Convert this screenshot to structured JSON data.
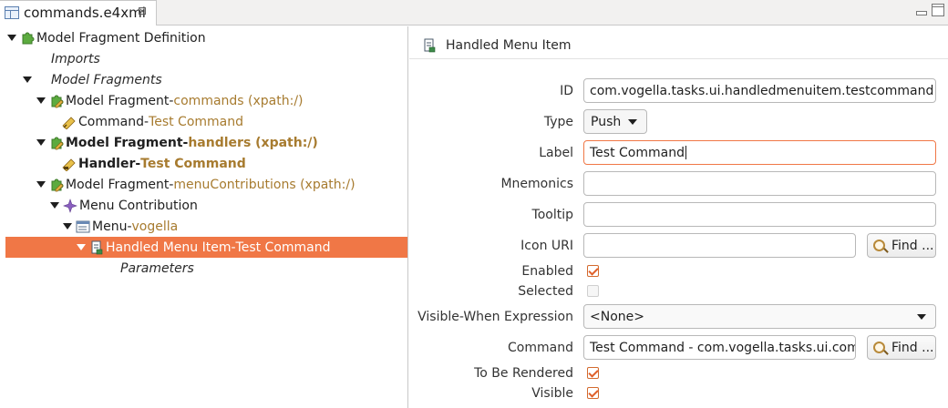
{
  "editor_tab": {
    "title": "commands.e4xmi",
    "close_glyph": "⊠"
  },
  "tree": {
    "rows": [
      {
        "main": "Model Fragment Definition",
        "dash": "",
        "sub": ""
      },
      {
        "main": "Imports",
        "dash": "",
        "sub": ""
      },
      {
        "main": "Model Fragments",
        "dash": "",
        "sub": ""
      },
      {
        "main": "Model Fragment",
        "dash": " - ",
        "sub": "commands (xpath:/)"
      },
      {
        "main": "Command",
        "dash": " - ",
        "sub": "Test Command"
      },
      {
        "main": "Model Fragment",
        "dash": " - ",
        "sub": "handlers (xpath:/)"
      },
      {
        "main": "Handler",
        "dash": " - ",
        "sub": "Test Command"
      },
      {
        "main": "Model Fragment",
        "dash": " - ",
        "sub": "menuContributions (xpath:/)"
      },
      {
        "main": "Menu Contribution",
        "dash": "",
        "sub": ""
      },
      {
        "main": "Menu",
        "dash": " - ",
        "sub": "vogella"
      },
      {
        "main": "Handled Menu Item",
        "dash": " - ",
        "sub": "Test Command"
      },
      {
        "main": "Parameters",
        "dash": "",
        "sub": ""
      }
    ]
  },
  "panel": {
    "title": "Handled Menu Item",
    "fields": {
      "id": {
        "label": "ID",
        "value": "com.vogella.tasks.ui.handledmenuitem.testcommand"
      },
      "type": {
        "label": "Type",
        "value": "Push"
      },
      "label": {
        "label": "Label",
        "value": "Test Command"
      },
      "mnemonics": {
        "label": "Mnemonics",
        "value": ""
      },
      "tooltip": {
        "label": "Tooltip",
        "value": ""
      },
      "icon_uri": {
        "label": "Icon URI",
        "value": "",
        "button": "Find ..."
      },
      "enabled": {
        "label": "Enabled",
        "checked": true
      },
      "selected": {
        "label": "Selected",
        "checked": false
      },
      "visible_when": {
        "label": "Visible-When Expression",
        "value": "<None>"
      },
      "command": {
        "label": "Command",
        "value": "Test Command - com.vogella.tasks.ui.comr",
        "button": "Find ..."
      },
      "to_be_rendered": {
        "label": "To Be Rendered",
        "checked": true
      },
      "visible": {
        "label": "Visible",
        "checked": true
      }
    }
  },
  "colors": {
    "selection": "#f07746",
    "sub_label": "#a77b2f",
    "focus_border": "#f07746"
  }
}
